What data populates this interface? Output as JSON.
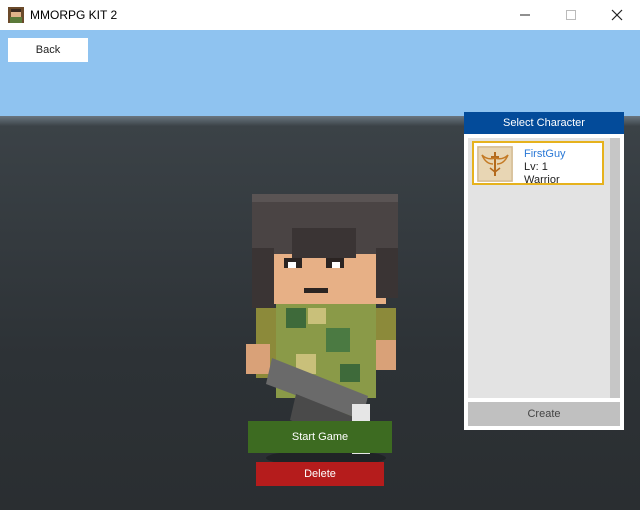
{
  "window": {
    "title": "MMORPG KIT 2",
    "icon": "app-icon",
    "controls": {
      "minimize": "minimize-icon",
      "maximize": "maximize-icon",
      "close": "close-icon"
    }
  },
  "toolbar": {
    "back_label": "Back"
  },
  "select_panel": {
    "title": "Select Character",
    "characters": [
      {
        "name": "FirstGuy",
        "level": "Lv: 1",
        "class": "Warrior",
        "emblem": "winged-sword-emblem-icon",
        "selected": true
      }
    ],
    "create_label": "Create"
  },
  "actions": {
    "start_label": "Start Game",
    "delete_label": "Delete"
  },
  "colors": {
    "sky": "#8fc3f0",
    "ground": "#2f3438",
    "panel_header": "#034b9a",
    "start_button": "#3d6b21",
    "delete_button": "#b51c1c",
    "selected_border": "#e6b21d",
    "character_name": "#2a78d6"
  }
}
